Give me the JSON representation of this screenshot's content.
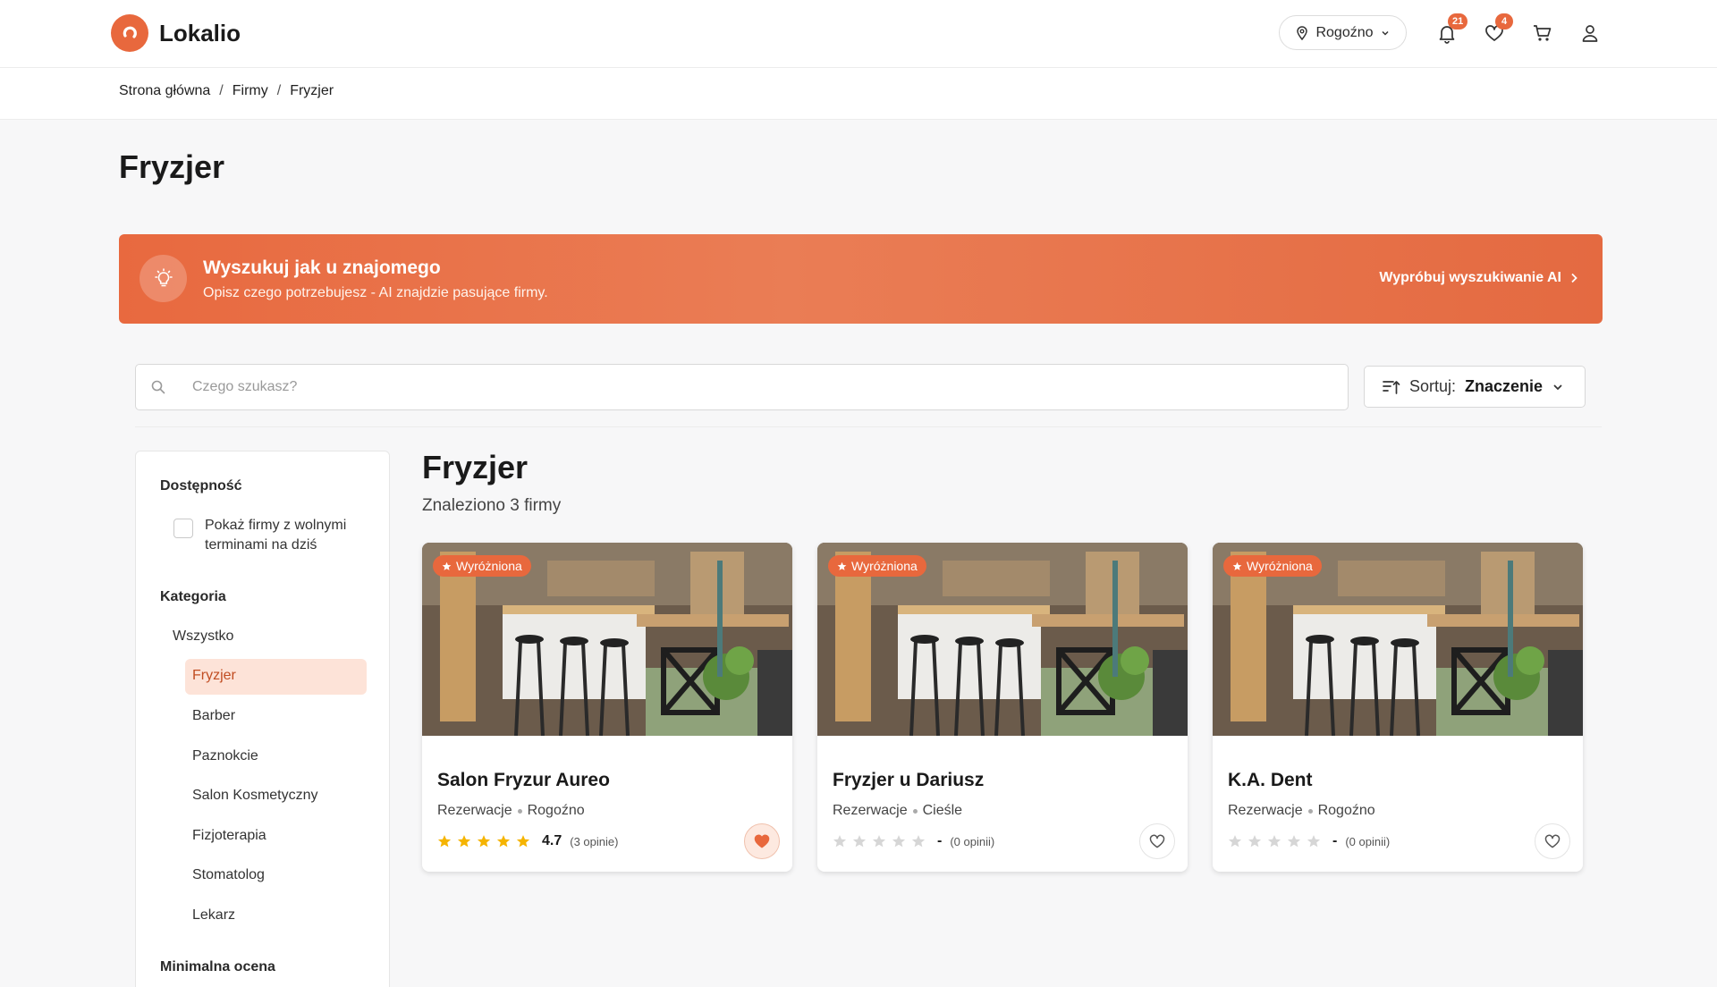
{
  "header": {
    "brand": "Lokalio",
    "location": "Rogoźno",
    "notifications_count": "21",
    "favorites_count": "4",
    "icons": [
      "location-pin-icon",
      "bell-icon",
      "heart-icon",
      "cart-icon",
      "user-icon"
    ]
  },
  "breadcrumb": {
    "items": [
      "Strona główna",
      "Firmy",
      "Fryzjer"
    ],
    "separator": "/"
  },
  "page": {
    "title": "Fryzjer"
  },
  "ai_banner": {
    "title": "Wyszukuj jak u znajomego",
    "subtitle": "Opisz czego potrzebujesz - AI znajdzie pasujące firmy.",
    "cta": "Wypróbuj wyszukiwanie AI"
  },
  "search": {
    "placeholder": "Czego szukasz?"
  },
  "sort": {
    "label": "Sortuj:",
    "value": "Znaczenie"
  },
  "filters": {
    "availability_title": "Dostępność",
    "availability_checkbox": "Pokaż firmy z wolnymi terminami na dziś",
    "category_title": "Kategoria",
    "categories": [
      "Wszystko",
      "Fryzjer",
      "Barber",
      "Paznokcie",
      "Salon Kosmetyczny",
      "Fizjoterapia",
      "Stomatolog",
      "Lekarz"
    ],
    "selected_category": "Fryzjer",
    "min_rating_title": "Minimalna ocena"
  },
  "results": {
    "title": "Fryzjer",
    "count_text": "Znaleziono 3 firmy",
    "featured_label": "Wyróżniona",
    "cards": [
      {
        "name": "Salon Fryzur Aureo",
        "category": "Rezerwacje",
        "city": "Rogoźno",
        "rating": "4.7",
        "rating_value": 4.7,
        "reviews": "(3 opinie)",
        "favorited": true
      },
      {
        "name": "Fryzjer u Dariusz",
        "category": "Rezerwacje",
        "city": "Cieśle",
        "rating": "-",
        "rating_value": 0,
        "reviews": "(0 opinii)",
        "favorited": false
      },
      {
        "name": "K.A. Dent",
        "category": "Rezerwacje",
        "city": "Rogoźno",
        "rating": "-",
        "rating_value": 0,
        "reviews": "(0 opinii)",
        "favorited": false
      }
    ]
  },
  "colors": {
    "accent": "#e8683d",
    "accent_light": "#fde3d8",
    "star": "#f5b400",
    "star_empty": "#d6d6d6"
  }
}
